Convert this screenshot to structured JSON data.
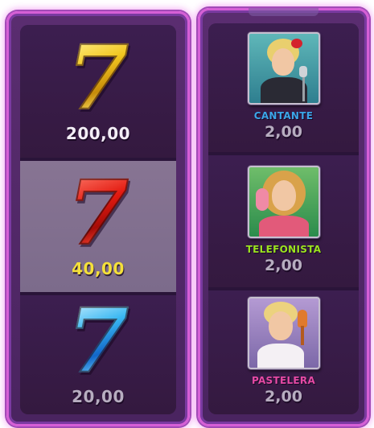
{
  "left_reel": {
    "symbols": [
      {
        "icon": "gold-seven-icon",
        "glyph": "7",
        "value": "200,00"
      },
      {
        "icon": "red-seven-icon",
        "glyph": "7",
        "value": "40,00",
        "highlighted": true
      },
      {
        "icon": "blue-seven-icon",
        "glyph": "7",
        "value": "20,00"
      }
    ]
  },
  "right_reel": {
    "characters": [
      {
        "icon": "singer-portrait-icon",
        "name": "CANTANTE",
        "value": "2,00",
        "name_color": "#3ba6e8"
      },
      {
        "icon": "telephone-operator-portrait-icon",
        "name": "TELEFONISTA",
        "value": "2,00",
        "name_color": "#9be21f"
      },
      {
        "icon": "pastry-chef-portrait-icon",
        "name": "PASTELERA",
        "value": "2,00",
        "name_color": "#e64aa5"
      }
    ]
  },
  "colors": {
    "frame_glow": "#d65fd6",
    "reel_background": "#3a1d4d",
    "highlight_cell": "#877493",
    "value_highlight": "#f4e03a",
    "value_top": "#f3eef6",
    "value_dim": "#b7adc0"
  }
}
